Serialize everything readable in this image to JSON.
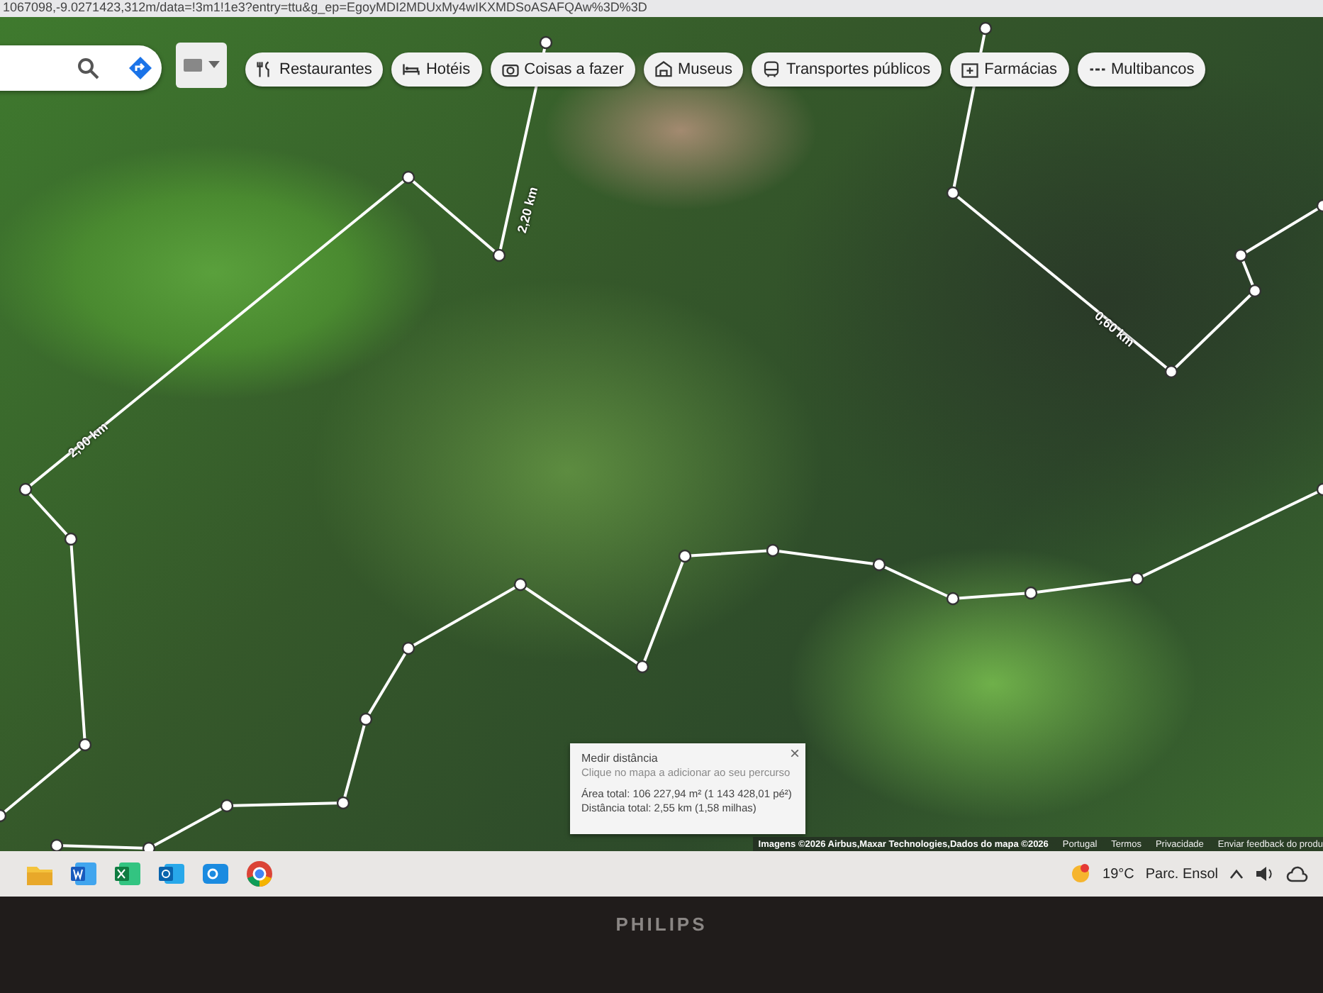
{
  "address_bar": {
    "url": "1067098,-9.0271423,312m/data=!3m1!1e3?entry=ttu&g_ep=EgoyMDI2MDUxMy4wIKXMDSoASAFQAw%3D%3D"
  },
  "chips": [
    {
      "label": "Restaurantes",
      "kind": "restaurant"
    },
    {
      "label": "Hotéis",
      "kind": "hotel"
    },
    {
      "label": "Coisas a fazer",
      "kind": "camera"
    },
    {
      "label": "Museus",
      "kind": "museum"
    },
    {
      "label": "Transportes públicos",
      "kind": "transit"
    },
    {
      "label": "Farmácias",
      "kind": "pharmacy"
    },
    {
      "label": "Multibancos",
      "kind": "atm"
    }
  ],
  "distance_labels": [
    "2,20 km",
    "2,00 km",
    "0,60 km"
  ],
  "measure_panel": {
    "title": "Medir distância",
    "hint": "Clique no mapa a adicionar ao seu percurso",
    "area": "Área total: 106 227,94 m² (1 143 428,01 pé²)",
    "distance": "Distância total: 2,55 km (1,58 milhas)",
    "close": "×"
  },
  "attribution": {
    "imagery": "Imagens ©2026 Airbus,Maxar Technologies,Dados do mapa ©2026",
    "links": [
      "Portugal",
      "Termos",
      "Privacidade",
      "Enviar feedback do produ"
    ]
  },
  "taskbar": {
    "apps": [
      {
        "kind": "folder"
      },
      {
        "kind": "word"
      },
      {
        "kind": "excel"
      },
      {
        "kind": "outlook"
      },
      {
        "kind": "outlook-new"
      },
      {
        "kind": "chrome"
      }
    ],
    "temperature": "19°C",
    "weather": "Parc. Ensol"
  },
  "monitor": {
    "brand": "PHILIPS"
  }
}
